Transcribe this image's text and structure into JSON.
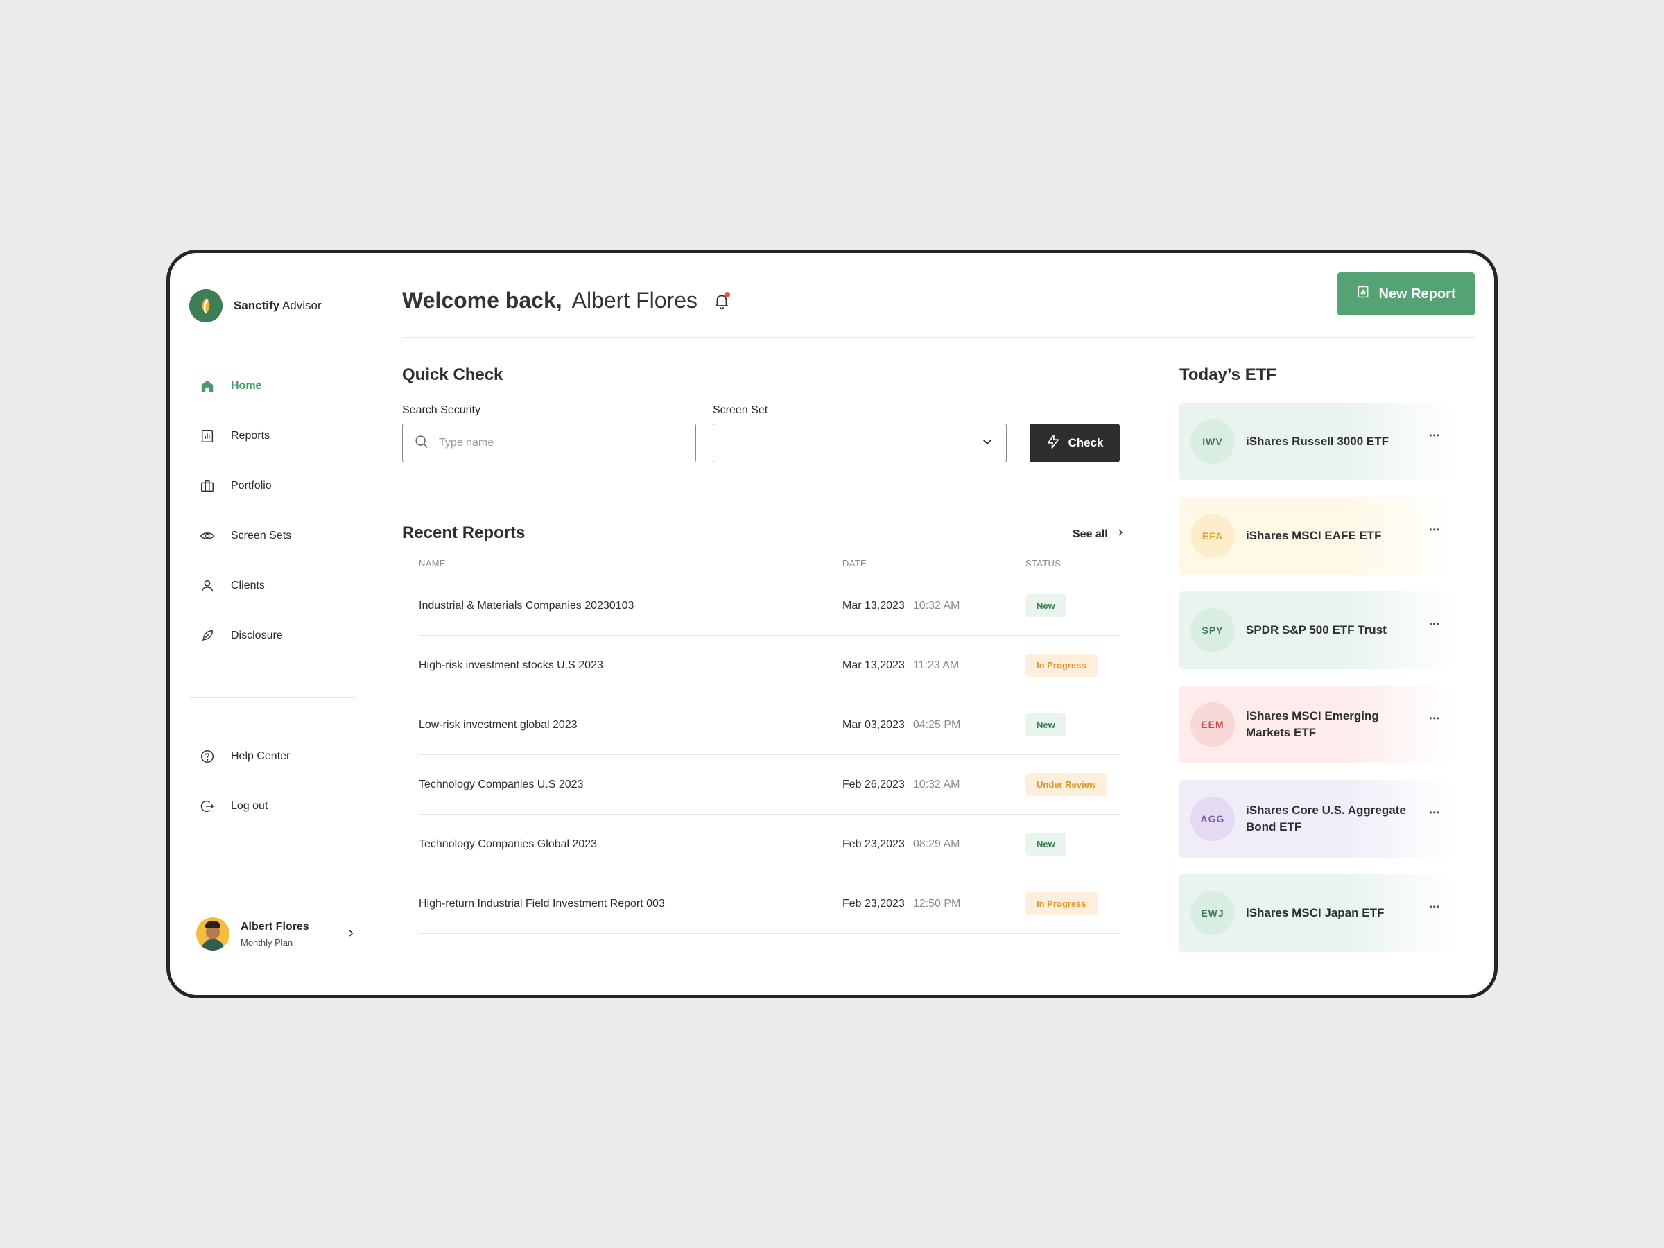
{
  "brand": {
    "name_bold": "Sanctify",
    "name_rest": "Advisor"
  },
  "sidebar": {
    "items": [
      {
        "label": "Home",
        "icon": "home-icon"
      },
      {
        "label": "Reports",
        "icon": "reports-icon"
      },
      {
        "label": "Portfolio",
        "icon": "briefcase-icon"
      },
      {
        "label": "Screen Sets",
        "icon": "eye-icon"
      },
      {
        "label": "Clients",
        "icon": "user-icon"
      },
      {
        "label": "Disclosure",
        "icon": "feather-icon"
      }
    ],
    "secondary": [
      {
        "label": "Help Center",
        "icon": "help-icon"
      },
      {
        "label": "Log out",
        "icon": "logout-icon"
      }
    ],
    "user": {
      "name": "Albert Flores",
      "plan": "Monthly Plan"
    }
  },
  "header": {
    "welcome": "Welcome back,",
    "name": "Albert Flores",
    "new_report_label": "New Report"
  },
  "quick_check": {
    "title": "Quick Check",
    "search_label": "Search Security",
    "search_placeholder": "Type name",
    "search_value": "",
    "screen_set_label": "Screen Set",
    "screen_set_value": "",
    "check_label": "Check"
  },
  "recent_reports": {
    "title": "Recent Reports",
    "see_all": "See all",
    "columns": [
      "NAME",
      "DATE",
      "STATUS"
    ],
    "rows": [
      {
        "name": "Industrial & Materials Companies 20230103",
        "date": "Mar 13,2023",
        "time": "10:32 AM",
        "status": "New",
        "status_kind": "new"
      },
      {
        "name": "High-risk investment stocks U.S 2023",
        "date": "Mar 13,2023",
        "time": "11:23 AM",
        "status": "In Progress",
        "status_kind": "progress"
      },
      {
        "name": "Low-risk investment global 2023",
        "date": "Mar 03,2023",
        "time": "04:25 PM",
        "status": "New",
        "status_kind": "new"
      },
      {
        "name": "Technology Companies U.S 2023",
        "date": "Feb 26,2023",
        "time": "10:32 AM",
        "status": "Under Review",
        "status_kind": "review"
      },
      {
        "name": "Technology Companies Global 2023",
        "date": "Feb 23,2023",
        "time": "08:29 AM",
        "status": "New",
        "status_kind": "new"
      },
      {
        "name": "High-return Industrial Field Investment Report 003",
        "date": "Feb 23,2023",
        "time": "12:50 PM",
        "status": "In Progress",
        "status_kind": "progress"
      }
    ]
  },
  "etf": {
    "title": "Today’s ETF",
    "items": [
      {
        "ticker": "IWV",
        "name": "iShares Russell 3000 ETF",
        "bg": "#e9f4ee",
        "circle": "#d9ede2",
        "ticker_color": "#3f7d57"
      },
      {
        "ticker": "EFA",
        "name": "iShares MSCI EAFE ETF",
        "bg": "#fff8e6",
        "circle": "#fdeecb",
        "ticker_color": "#e0a12a"
      },
      {
        "ticker": "SPY",
        "name": "SPDR S&P 500 ETF Trust",
        "bg": "#e9f4ee",
        "circle": "#d9ede2",
        "ticker_color": "#3f7d57"
      },
      {
        "ticker": "EEM",
        "name": "iShares MSCI Emerging Markets ETF",
        "bg": "#fdeceb",
        "circle": "#f9d9d7",
        "ticker_color": "#c0504d"
      },
      {
        "ticker": "AGG",
        "name": "iShares Core U.S. Aggregate Bond ETF",
        "bg": "#f1edf8",
        "circle": "#e4dbf2",
        "ticker_color": "#7a5aa8"
      },
      {
        "ticker": "EWJ",
        "name": "iShares MSCI Japan ETF",
        "bg": "#e9f4ee",
        "circle": "#d9ede2",
        "ticker_color": "#3f7d57"
      }
    ]
  },
  "colors": {
    "accent": "#55a274",
    "dark_button": "#2d2d2d",
    "notification": "#ef4b4b"
  }
}
